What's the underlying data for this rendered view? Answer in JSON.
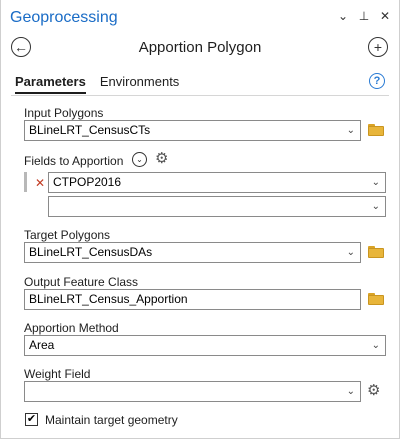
{
  "window": {
    "title": "Geoprocessing",
    "controls": {
      "menu": "⌄",
      "pin": "⊥",
      "close": "✕"
    }
  },
  "tool": {
    "title": "Apportion Polygon",
    "back_glyph": "←",
    "add_glyph": "+"
  },
  "tabs": [
    {
      "label": "Parameters",
      "active": true
    },
    {
      "label": "Environments",
      "active": false
    }
  ],
  "help_glyph": "?",
  "params": {
    "input_polygons": {
      "label": "Input Polygons",
      "value": "BLineLRT_CensusCTs"
    },
    "fields_to_apportion": {
      "label": "Fields to Apportion",
      "rows": [
        {
          "value": "CTPOP2016"
        },
        {
          "value": ""
        }
      ]
    },
    "target_polygons": {
      "label": "Target Polygons",
      "value": "BLineLRT_CensusDAs"
    },
    "output_feature_class": {
      "label": "Output Feature Class",
      "value": "BLineLRT_Census_Apportion"
    },
    "apportion_method": {
      "label": "Apportion Method",
      "value": "Area"
    },
    "weight_field": {
      "label": "Weight Field",
      "value": ""
    },
    "maintain_target_geometry": {
      "label": "Maintain target geometry",
      "checked": true
    }
  },
  "glyphs": {
    "dropdown": "⌄",
    "remove": "✕",
    "gear": "⚙",
    "check": "✔",
    "toggle": "⌄"
  },
  "colors": {
    "accent": "#1a6cc6",
    "folder": "#e8b53a",
    "remove": "#c23b22"
  }
}
